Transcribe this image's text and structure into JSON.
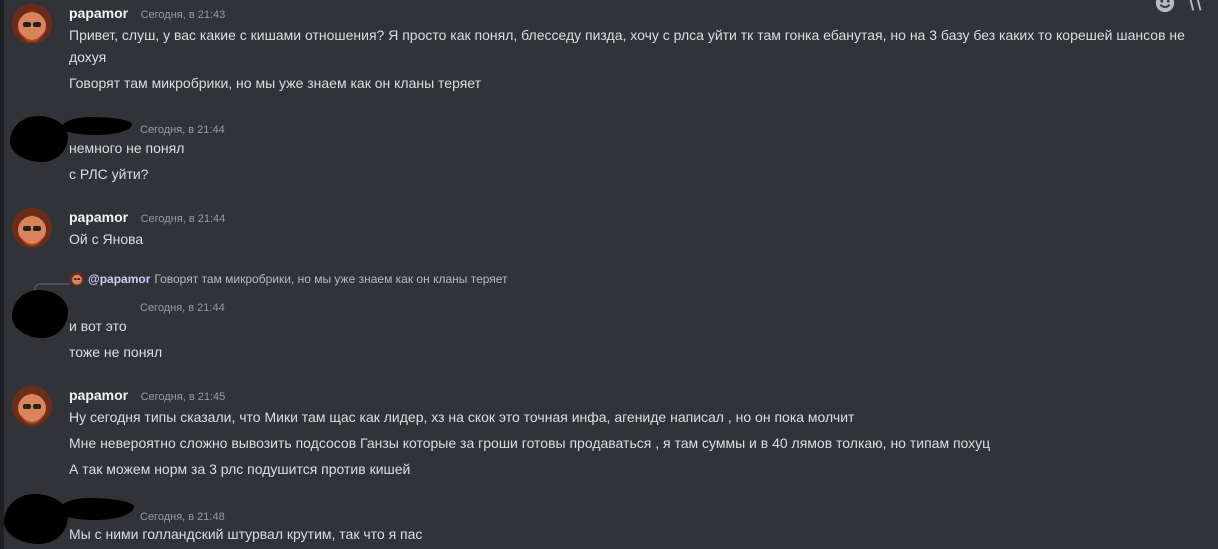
{
  "colors": {
    "background": "#313338",
    "username": "#f2f3f5",
    "timestamp": "#949ba4",
    "text": "#dbdee1",
    "mention": "#c9cdfb"
  },
  "toolbar": {
    "icons": [
      "emoji-icon",
      "reaction-icon"
    ]
  },
  "groups": [
    {
      "author": "papamor",
      "timestamp": "Сегодня, в 21:43",
      "messages": [
        "Привет, слуш, у вас какие с кишами отношения? Я просто как понял, блесседу пизда, хочу с рлса уйти тк там гонка ебанутая, но на 3 базу без каких то корешей шансов не дохуя",
        "Говорят там микробрики, но мы уже знаем как он кланы теряет"
      ]
    },
    {
      "author": "",
      "timestamp": "Сегодня, в 21:44",
      "messages": [
        "немного не понял",
        "с РЛС уйти?"
      ]
    },
    {
      "author": "papamor",
      "timestamp": "Сегодня, в 21:44",
      "messages": [
        "Ой с Янова"
      ]
    },
    {
      "author": "",
      "timestamp": "Сегодня, в 21:44",
      "reply": {
        "mention": "@papamor",
        "text": "Говорят там микробрики, но мы уже знаем как он кланы теряет"
      },
      "messages": [
        "и вот это",
        "тоже не понял"
      ]
    },
    {
      "author": "papamor",
      "timestamp": "Сегодня, в 21:45",
      "messages": [
        "Ну сегодня типы сказали, что Мики там щас как лидер, хз на скок это точная инфа, агениде написал , но он пока молчит",
        "Мне невероятно сложно вывозить подсосов Ганзы которые за гроши готовы продаваться , я там суммы и в 40 лямов толкаю, но типам похуц",
        "А так можем норм за 3 рлс подушится против кишей"
      ]
    },
    {
      "author": "",
      "timestamp": "Сегодня, в 21:48",
      "messages": [
        "Мы с ними голландский штурвал крутим, так что я пас"
      ]
    }
  ]
}
